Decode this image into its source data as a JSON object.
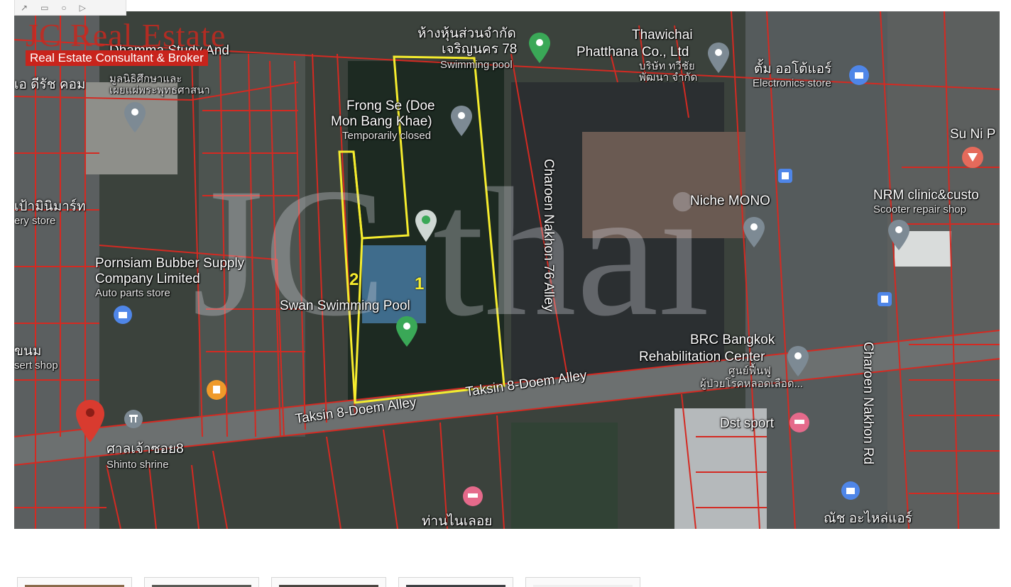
{
  "toolbar": {
    "icons": [
      "pointer-icon",
      "rectangle-icon",
      "circle-icon",
      "play-icon"
    ]
  },
  "brand": {
    "title": "JC Real Estate",
    "tagline": "Real Estate Consultant & Broker"
  },
  "watermark": {
    "text": "JC thai"
  },
  "plots": {
    "plot_1": "1",
    "plot_2": "2"
  },
  "places": {
    "dhamma_line1": "Dhamma Study And",
    "dhamma_thai": "มูลนิธิศึกษาและ",
    "dhamma_thai2": "เผยแผ่พระพุทธศาสนา",
    "dee_rich": "เอ ดีรัช คอม",
    "hang_thai": "ห้างหุ้นส่วนจำกัด",
    "hang_thai2": "เจริญนคร 78",
    "swimming_pool_top": "Swimming pool",
    "thawichai": "Thawichai",
    "phatthana": "Phatthana Co., Ltd",
    "phatthana_thai": "บริษัท ทวีชัย",
    "phatthana_thai2": "พัฒนา จำกัด",
    "electronics_thai": "ตั้ม ออโต้แอร์",
    "electronics": "Electronics store",
    "frong_1": "Frong Se (Doe",
    "frong_2": "Mon Bang Khae)",
    "frong_3": "Temporarily closed",
    "su_ni": "Su Ni P",
    "mini_mart_thai": "เป้ามินิมาร์ท",
    "mini_mart": "ery store",
    "niche": "Niche MONO",
    "nrm": "NRM clinic&custo",
    "scooter": "Scooter repair shop",
    "pornsiam_1": "Pornsiam Bubber Supply",
    "pornsiam_2": "Company Limited",
    "pornsiam_3": "Auto parts store",
    "swan": "Swan Swimming Pool",
    "brc_1": "BRC Bangkok",
    "brc_2": "Rehabilitation Center",
    "brc_thai": "ศูนย์ฟื้นฟู",
    "brc_thai2": "ผู้ป่วยโรคหลอดเลือด...",
    "dessert_thai": "ขนม",
    "dessert": "sert shop",
    "shrine_thai": "ศาลเจ้าซอย8",
    "shrine": "Shinto shrine",
    "dst": "Dst sport",
    "bottom_thai": "ท่านไนเลอย",
    "bottom_right_thai": "ณัช อะไหล่แอร์"
  },
  "roads": {
    "taksin_a": "Taksin 8-Doem Alley",
    "taksin_b": "Taksin 8-Doem Alley",
    "charoen_76": "Charoen Nakhon 76 Alley",
    "charoen_rd": "Charoen Nakhon Rd"
  },
  "colors": {
    "parcel_line": "#d42a22",
    "plot_outline": "#f5ec2e",
    "pin_red": "#d93b2f",
    "pin_green": "#3aa857",
    "pin_gray": "#7d8a94",
    "pin_blue": "#4f86e8",
    "pin_pink": "#e56a8b",
    "pin_orange": "#ef9a2a"
  },
  "thumbnails": [
    "photo-1",
    "photo-2",
    "photo-3",
    "photo-4",
    "photo-5"
  ]
}
